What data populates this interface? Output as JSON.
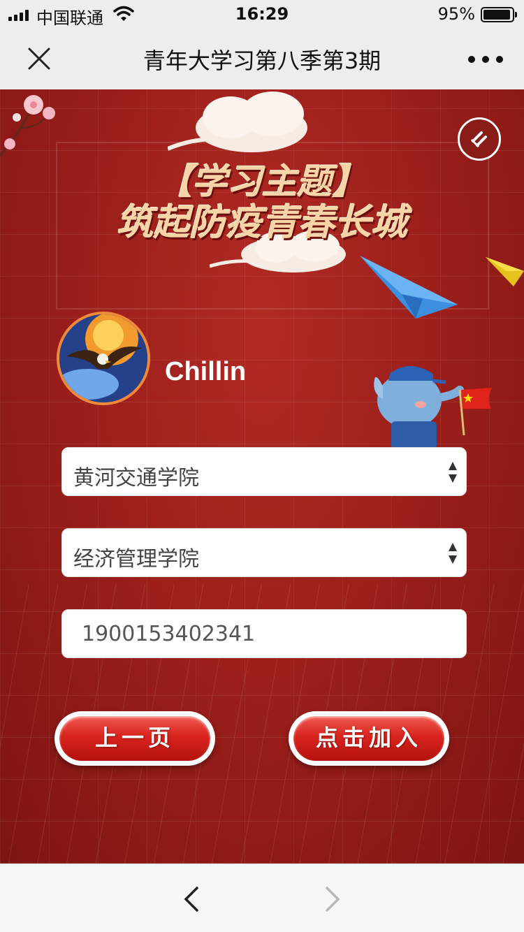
{
  "status_bar": {
    "carrier": "中国联通",
    "time": "16:29",
    "battery_percent": "95%"
  },
  "nav": {
    "title": "青年大学习第八季第3期"
  },
  "topic": {
    "line1": "【学习主题】",
    "line2": "筑起防疫青春长城"
  },
  "user": {
    "name": "Chillin"
  },
  "form": {
    "school": "黄河交通学院",
    "college": "经济管理学院",
    "id_number": "1900153402341"
  },
  "buttons": {
    "prev": "上一页",
    "join": "点击加入"
  },
  "colors": {
    "background_red": "#9c1f1a",
    "button_red": "#d8231d",
    "avatar_ring": "#f08a3a"
  }
}
